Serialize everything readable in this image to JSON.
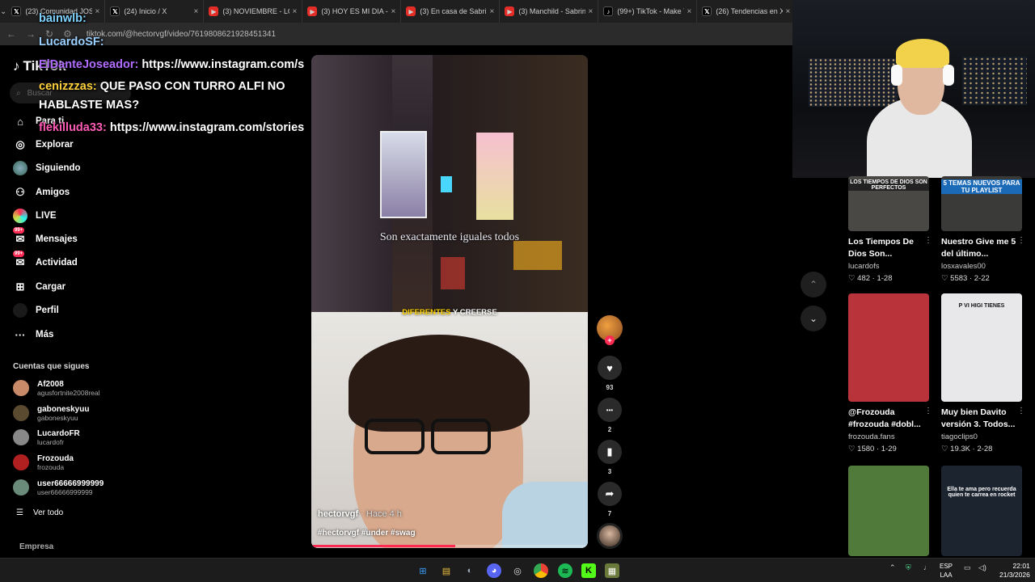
{
  "browser": {
    "tabs": [
      {
        "label": "(23) Comunidad JOSE",
        "icon": "x-icon"
      },
      {
        "label": "(24) Inicio / X",
        "icon": "x-icon"
      },
      {
        "label": "(3) NOVIEMBRE - LO",
        "icon": "youtube-icon"
      },
      {
        "label": "(3) HOY ES MI DIA -",
        "icon": "youtube-icon"
      },
      {
        "label": "(3) En casa de Sabrin",
        "icon": "youtube-icon"
      },
      {
        "label": "(3) Manchild - Sabrin",
        "icon": "youtube-icon"
      },
      {
        "label": "(99+) TikTok - Make Y",
        "icon": "tiktok-icon"
      },
      {
        "label": "(26) Tendencias en X",
        "icon": "x-icon"
      }
    ],
    "url": "tiktok.com/@hectorvgf/video/7619808621928451341"
  },
  "sidebar": {
    "logo": "TikTok",
    "search_placeholder": "Buscar",
    "nav": [
      {
        "label": "Para ti",
        "icon": "home-icon"
      },
      {
        "label": "Explorar",
        "icon": "compass-icon"
      },
      {
        "label": "Siguiendo",
        "icon": "following-avatar-icon"
      },
      {
        "label": "Amigos",
        "icon": "friends-icon"
      },
      {
        "label": "LIVE",
        "icon": "live-icon"
      },
      {
        "label": "Mensajes",
        "icon": "messages-icon",
        "badge": "99+"
      },
      {
        "label": "Actividad",
        "icon": "activity-icon",
        "badge": "99+"
      },
      {
        "label": "Cargar",
        "icon": "upload-icon"
      },
      {
        "label": "Perfil",
        "icon": "profile-icon"
      },
      {
        "label": "Más",
        "icon": "more-icon"
      }
    ],
    "following_title": "Cuentas que sigues",
    "accounts": [
      {
        "name": "Af2008",
        "handle": "agusfortnite2008real",
        "color": "#c98a6a"
      },
      {
        "name": "gaboneskyuu",
        "handle": "gaboneskyuu",
        "color": "#5a4a30"
      },
      {
        "name": "LucardoFR",
        "handle": "lucardofr",
        "color": "#888888"
      },
      {
        "name": "Frozouda",
        "handle": "frozouda",
        "color": "#b02020"
      },
      {
        "name": "user66666999999",
        "handle": "user66666999999",
        "color": "#6a8a7a"
      }
    ],
    "see_all": "Ver todo",
    "footer": "Empresa"
  },
  "chat": [
    {
      "user": "bainwlb:",
      "message": "",
      "color": "#7fd3ff"
    },
    {
      "user": "LucardoSF:",
      "message": "",
      "color": "#9ad0ff"
    },
    {
      "user": "ElDanteJoseador:",
      "message": "https://www.instagram.com/s",
      "color": "#b06cff"
    },
    {
      "user": "cenizzzas:",
      "message": "QUE PASO CON TURRO ALFI NO",
      "color": "#ffd23c"
    },
    {
      "user": "",
      "message": "HABLASTE MAS?",
      "color": "#ffffff"
    },
    {
      "user": "flekilluda33:",
      "message": "https://www.instagram.com/stories",
      "color": "#ff5ab4"
    }
  ],
  "video": {
    "caption_overlay": "Son exactamente iguales todos",
    "subtitle_highlight": "DIFERENTES",
    "subtitle_rest": " Y CREERSE",
    "author": "hectorvgf",
    "time": " · Hace 4 h",
    "tags": "#hectorvgf #under #swag",
    "progress_percent": 52
  },
  "actions": [
    {
      "name": "like",
      "icon": "heart-icon",
      "count": "93"
    },
    {
      "name": "comment",
      "icon": "comment-icon",
      "count": "2"
    },
    {
      "name": "save",
      "icon": "bookmark-icon",
      "count": "3"
    },
    {
      "name": "share",
      "icon": "share-icon",
      "count": "7"
    }
  ],
  "recommended": [
    {
      "title": "Los Tiempos De Dios Son...",
      "author": "lucardofs",
      "likes": "482",
      "date": "1-28",
      "thumb_text": "LOS TIEMPOS DE DIOS SON PERFECTOS",
      "bg": "#4a4844"
    },
    {
      "title": "Nuestro Give me 5 del último...",
      "author": "losxavales00",
      "likes": "5583",
      "date": "2-22",
      "thumb_text": "5 TEMAS NUEVOS PARA TU PLAYLIST",
      "bg": "#3a3a38"
    },
    {
      "title": "@Frozouda #frozouda #dobl...",
      "author": "frozouda.fans",
      "likes": "1580",
      "date": "1-29",
      "thumb_text": "",
      "bg": "#b8343a"
    },
    {
      "title": "Muy bien Davito versión 3. Todos...",
      "author": "tiagoclips0",
      "likes": "19.3K",
      "date": "2-28",
      "thumb_text": "P VI HIGI TIENES",
      "bg": "#e8e8ea"
    },
    {
      "title": "",
      "author": "",
      "likes": "",
      "date": "",
      "thumb_text": "",
      "bg": "#4f7a3a"
    },
    {
      "title": "",
      "author": "",
      "likes": "",
      "date": "",
      "thumb_text": "Ella te ama pero recuerda quien te carrea en rocket",
      "bg": "#1c2430"
    }
  ],
  "taskbar": {
    "lang_top": "ESP",
    "lang_bottom": "LAA",
    "time": "22:01",
    "date": "21/3/2026"
  },
  "colors": {
    "accent": "#fe2c55",
    "background": "#000000"
  }
}
